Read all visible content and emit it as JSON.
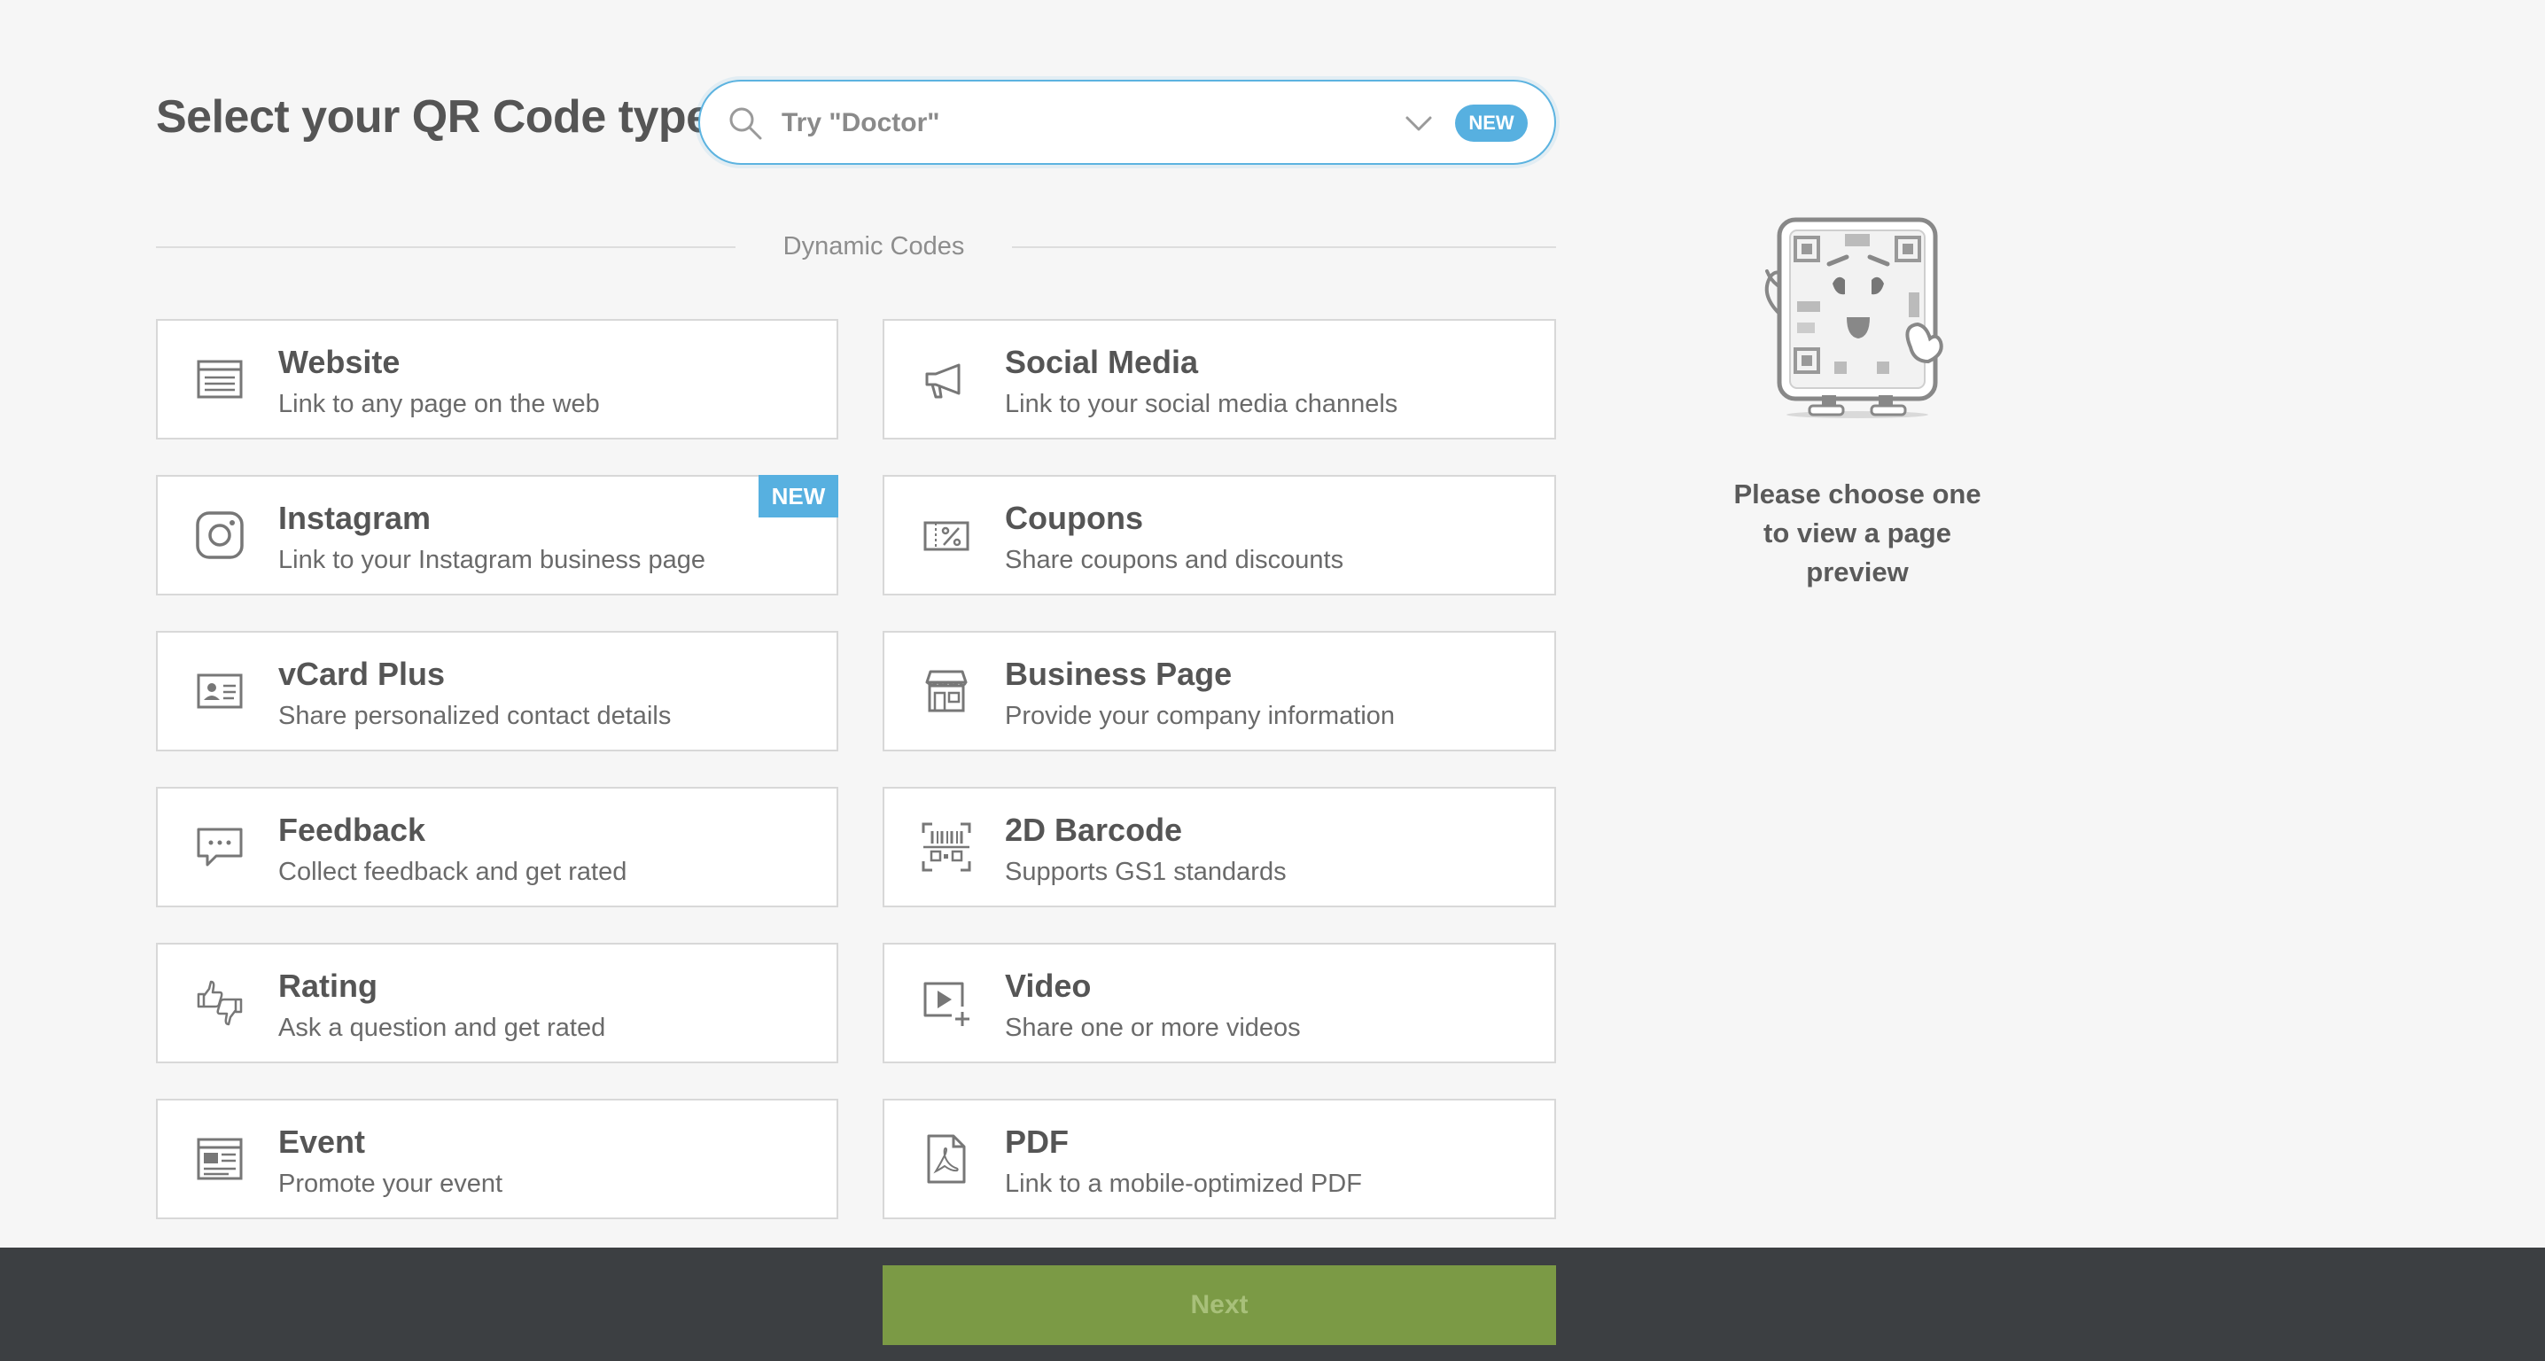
{
  "header": {
    "title": "Select your QR Code type"
  },
  "search": {
    "placeholder": "Try \"Doctor\"",
    "badge": "NEW"
  },
  "section": {
    "label": "Dynamic Codes"
  },
  "cards": [
    {
      "name": "Website",
      "desc": "Link to any page on the web",
      "icon": "browser-window-icon"
    },
    {
      "name": "Social Media",
      "desc": "Link to your social media channels",
      "icon": "megaphone-icon"
    },
    {
      "name": "Instagram",
      "desc": "Link to your Instagram business page",
      "icon": "instagram-icon",
      "badge": "NEW"
    },
    {
      "name": "Coupons",
      "desc": "Share coupons and discounts",
      "icon": "coupon-icon"
    },
    {
      "name": "vCard Plus",
      "desc": "Share personalized contact details",
      "icon": "contact-card-icon"
    },
    {
      "name": "Business Page",
      "desc": "Provide your company information",
      "icon": "storefront-icon"
    },
    {
      "name": "Feedback",
      "desc": "Collect feedback and get rated",
      "icon": "chat-bubble-icon"
    },
    {
      "name": "2D Barcode",
      "desc": "Supports GS1 standards",
      "icon": "barcode-scan-icon"
    },
    {
      "name": "Rating",
      "desc": "Ask a question and get rated",
      "icon": "thumbs-up-down-icon"
    },
    {
      "name": "Video",
      "desc": "Share one or more videos",
      "icon": "video-play-icon"
    },
    {
      "name": "Event",
      "desc": "Promote your event",
      "icon": "event-calendar-icon"
    },
    {
      "name": "PDF",
      "desc": "Link to a mobile-optimized PDF",
      "icon": "pdf-document-icon"
    }
  ],
  "preview": {
    "text": "Please choose one to view a page preview",
    "icon": "qr-mascot-illustration"
  },
  "footer": {
    "next_label": "Next"
  },
  "colors": {
    "accent": "#57b0e0",
    "next_button": "#7b9a45",
    "footer_bg": "#3c3f42",
    "page_bg": "#f6f6f6"
  }
}
